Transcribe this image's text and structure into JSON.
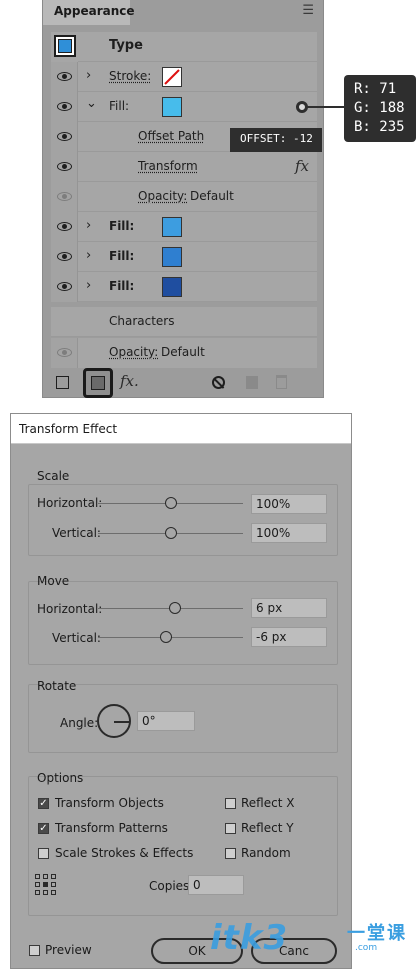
{
  "appearance": {
    "tab": "Appearance",
    "header_label": "Type",
    "rows": [
      {
        "label": "Stroke:",
        "swatch": "#ffffff",
        "has_slash": true,
        "eye": true,
        "chevron": ">"
      },
      {
        "label": "Fill:",
        "swatch": "#47bceb",
        "eye": true,
        "chevron": "v"
      },
      {
        "label": "Offset Path",
        "eye": true
      },
      {
        "label": "Transform",
        "eye": true,
        "fx": "fx"
      },
      {
        "label": "Opacity:",
        "value": "Default",
        "eye": false
      },
      {
        "label": "Fill:",
        "swatch": "#3d9de0",
        "eye": true,
        "chevron": ">"
      },
      {
        "label": "Fill:",
        "swatch": "#2f7fd0",
        "eye": true,
        "chevron": ">"
      },
      {
        "label": "Fill:",
        "swatch": "#1f4ea0",
        "eye": true,
        "chevron": ">"
      },
      {
        "label": "Characters"
      },
      {
        "label": "Opacity:",
        "value": "Default",
        "eye": false
      }
    ],
    "footer_fx": "fx."
  },
  "callouts": {
    "rgb": [
      "R: 71",
      "G: 188",
      "B: 235"
    ],
    "offset": "OFFSET: -12"
  },
  "dialog": {
    "title": "Transform Effect",
    "scale": {
      "title": "Scale",
      "horizontal_label": "Horizontal:",
      "horizontal_value": "100%",
      "horizontal_pos": 0.5,
      "vertical_label": "Vertical:",
      "vertical_value": "100%",
      "vertical_pos": 0.5
    },
    "move": {
      "title": "Move",
      "horizontal_label": "Horizontal:",
      "horizontal_value": "6 px",
      "horizontal_pos": 0.53,
      "vertical_label": "Vertical:",
      "vertical_value": "-6 px",
      "vertical_pos": 0.47
    },
    "rotate": {
      "title": "Rotate",
      "angle_label": "Angle:",
      "angle_value": "0°"
    },
    "options": {
      "title": "Options",
      "transform_objects": "Transform Objects",
      "transform_objects_checked": true,
      "transform_patterns": "Transform Patterns",
      "transform_patterns_checked": true,
      "scale_strokes": "Scale Strokes & Effects",
      "scale_strokes_checked": false,
      "reflect_x": "Reflect X",
      "reflect_x_checked": false,
      "reflect_y": "Reflect Y",
      "reflect_y_checked": false,
      "random": "Random",
      "random_checked": false,
      "copies_label": "Copies",
      "copies_value": "0"
    },
    "preview_label": "Preview",
    "ok_label": "OK",
    "cancel_label": "Canc"
  },
  "watermark": {
    "text": "itk3",
    "cn": "一堂课",
    "url": ".com"
  }
}
